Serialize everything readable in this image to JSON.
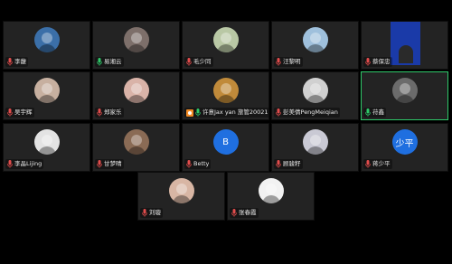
{
  "participants": [
    {
      "name": "李馥",
      "muted": true,
      "avatar_color": "#3b6fa8"
    },
    {
      "name": "易湘云",
      "muted": false,
      "avatar_color": "#7d6f6a"
    },
    {
      "name": "毛少同",
      "muted": true,
      "avatar_color": "#b9c8a5"
    },
    {
      "name": "汪黎明",
      "muted": true,
      "avatar_color": "#9fc0dc"
    },
    {
      "name": "蔡保忠",
      "muted": true,
      "avatar_color": "#1a3aa8",
      "video": true
    },
    {
      "name": "吴宇辉",
      "muted": true,
      "avatar_color": "#c7b0a0"
    },
    {
      "name": "郑家乐",
      "muted": true,
      "avatar_color": "#d9b3a8"
    },
    {
      "name": "许意Jax yan 旅管20021",
      "muted": false,
      "sharing": true,
      "avatar_color": "#c08a3a"
    },
    {
      "name": "彭美倩PengMeiqian",
      "muted": true,
      "avatar_color": "#d0d0d0"
    },
    {
      "name": "苻鑫",
      "muted": false,
      "active": true,
      "avatar_color": "#6b6b6b"
    },
    {
      "name": "李晶Lijing",
      "muted": true,
      "avatar_color": "#e3e3e3"
    },
    {
      "name": "甘梦晴",
      "muted": true,
      "avatar_color": "#8a6b55"
    },
    {
      "name": "Betty",
      "muted": true,
      "avatar_color": "#1f6fe0",
      "letter": "B"
    },
    {
      "name": "顾骏籽",
      "muted": true,
      "avatar_color": "#c9c9d4"
    },
    {
      "name": "蒋少平",
      "muted": true,
      "avatar_color": "#1f6fe0",
      "letter": "少平"
    },
    {
      "name": "刘璇",
      "muted": true,
      "avatar_color": "#d8b6a4"
    },
    {
      "name": "张春霞",
      "muted": true,
      "avatar_color": "#f2f2f2"
    }
  ],
  "colors": {
    "tile_bg": "#232323",
    "active_border": "#2fc96a",
    "muted_icon": "#e24c4c",
    "unmuted_icon": "#2fc96a"
  }
}
